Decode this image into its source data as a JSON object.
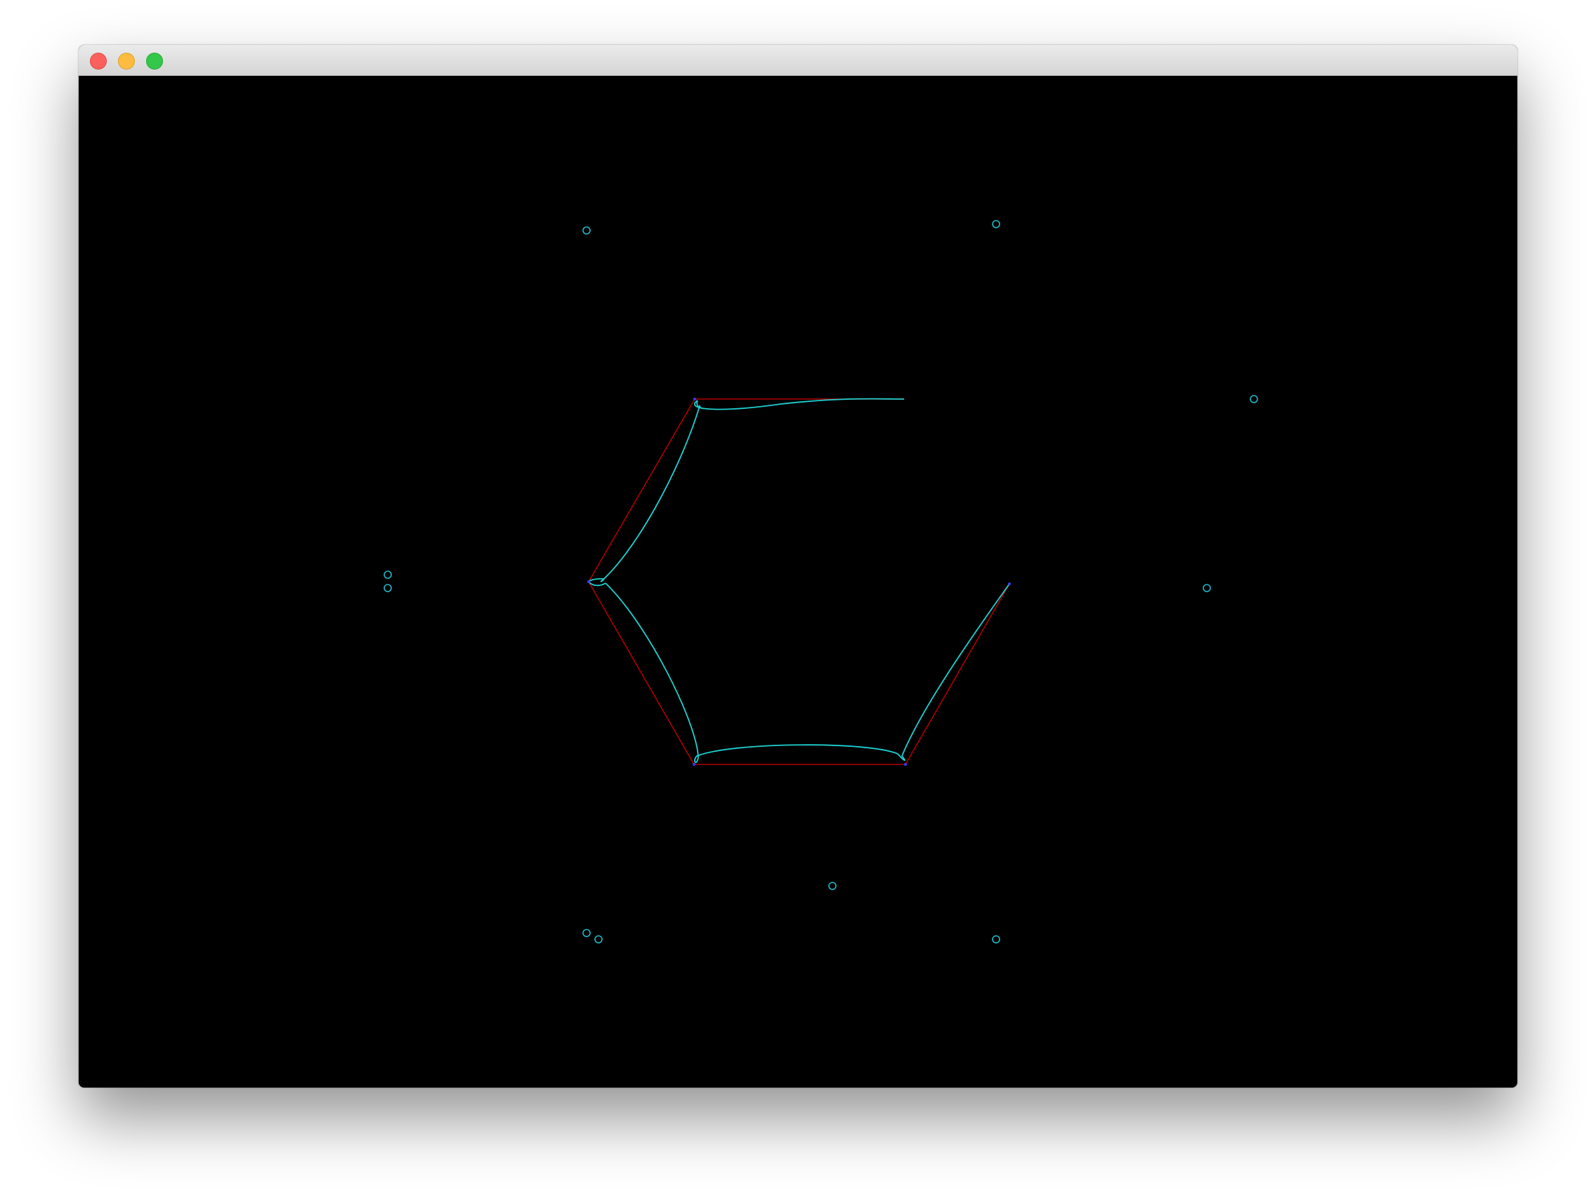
{
  "window": {
    "title": "",
    "controls": {
      "close": "close-button",
      "minimize": "minimize-button",
      "zoom": "zoom-button"
    }
  },
  "canvas": {
    "background": "#000000",
    "colors": {
      "polygon": "#b00000",
      "curve": "#1fd0d0",
      "marker": "#1fb8c8",
      "vertex": "#3a3aff"
    }
  }
}
